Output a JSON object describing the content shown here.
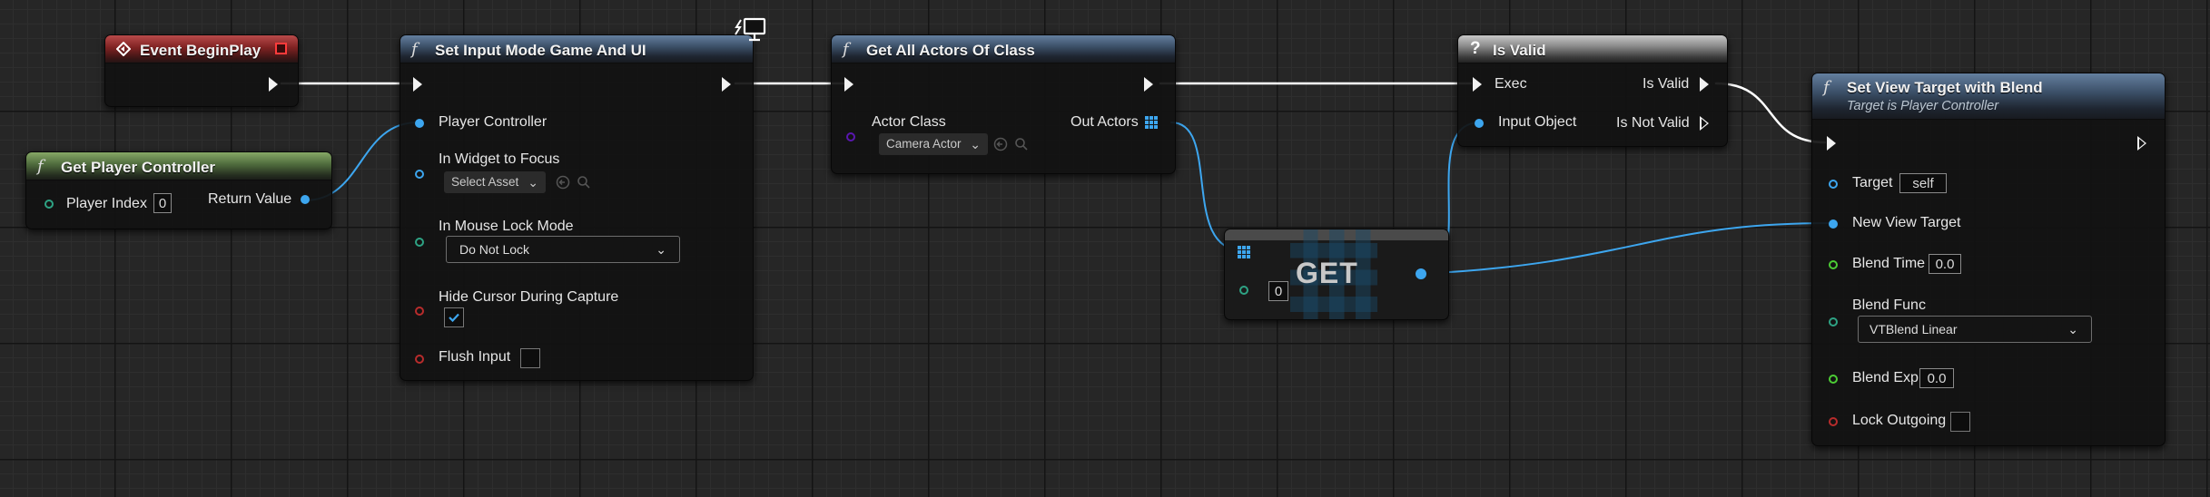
{
  "nodes": {
    "begin_play": {
      "title": "Event BeginPlay"
    },
    "get_player_controller": {
      "title": "Get Player Controller",
      "player_index_label": "Player Index",
      "player_index_value": "0",
      "return_value_label": "Return Value"
    },
    "set_input_mode": {
      "title": "Set Input Mode Game And UI",
      "player_controller_label": "Player Controller",
      "widget_focus_label": "In Widget to Focus",
      "widget_focus_value": "Select Asset",
      "mouse_lock_label": "In Mouse Lock Mode",
      "mouse_lock_value": "Do Not Lock",
      "hide_cursor_label": "Hide Cursor During Capture",
      "hide_cursor_checked": true,
      "flush_input_label": "Flush Input",
      "flush_input_checked": false
    },
    "get_all_actors": {
      "title": "Get All Actors Of Class",
      "actor_class_label": "Actor Class",
      "actor_class_value": "Camera Actor",
      "out_actors_label": "Out Actors"
    },
    "get_array": {
      "title": "GET",
      "index_value": "0"
    },
    "is_valid": {
      "title": "Is Valid",
      "exec_label": "Exec",
      "input_object_label": "Input Object",
      "is_valid_label": "Is Valid",
      "is_not_valid_label": "Is Not Valid"
    },
    "set_view_target": {
      "title": "Set View Target with Blend",
      "subtitle": "Target is Player Controller",
      "target_label": "Target",
      "target_value": "self",
      "new_view_target_label": "New View Target",
      "blend_time_label": "Blend Time",
      "blend_time_value": "0.0",
      "blend_func_label": "Blend Func",
      "blend_func_value": "VTBlend Linear",
      "blend_exp_label": "Blend Exp",
      "blend_exp_value": "0.0",
      "lock_outgoing_label": "Lock Outgoing",
      "lock_outgoing_checked": false
    }
  },
  "colors": {
    "exec_wire": "#ffffff",
    "object_wire": "#3da6ef",
    "grid_bg": "#262626"
  },
  "icons": [
    "event-icon",
    "function-icon",
    "question-icon",
    "monitor-icon",
    "array-grid-icon",
    "browse-arrow-icon",
    "search-icon",
    "checkmark-icon",
    "chevron-down-icon"
  ]
}
